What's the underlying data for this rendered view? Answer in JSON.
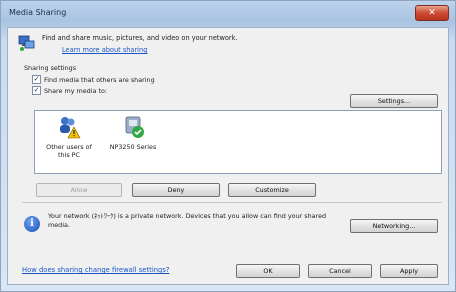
{
  "window": {
    "title": "Media Sharing",
    "close_label": "✕"
  },
  "intro": {
    "text": "Find and share music, pictures, and video on your network.",
    "link": "Learn more about sharing"
  },
  "settings": {
    "label": "Sharing settings",
    "find_media": {
      "label": "Find media that others are sharing",
      "checked": true
    },
    "share_media": {
      "label": "Share my media to:",
      "checked": true
    },
    "settings_button": "Settings..."
  },
  "devices": [
    {
      "label_line1": "Other users of",
      "label_line2": "this PC",
      "icon": "users-warning-icon"
    },
    {
      "label_line1": "NP3250 Series",
      "label_line2": "",
      "icon": "projector-check-icon"
    }
  ],
  "actions": {
    "allow": "Allow",
    "deny": "Deny",
    "customize": "Customize"
  },
  "network": {
    "text": "Your network (ﾈｯﾄﾜｰｸ) is a private network. Devices that you allow can find your shared media.",
    "networking_button": "Networking..."
  },
  "footer": {
    "firewall_link": "How does sharing change firewall settings?",
    "ok": "OK",
    "cancel": "Cancel",
    "apply": "Apply"
  },
  "colors": {
    "link": "#1a55c8",
    "close": "#cc4a32"
  }
}
